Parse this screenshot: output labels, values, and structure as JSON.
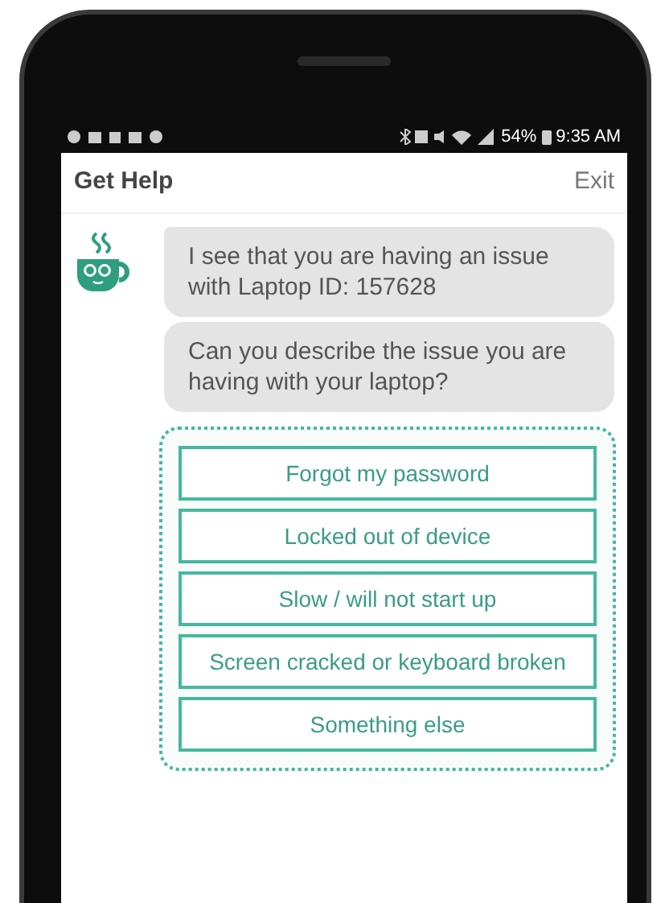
{
  "status_bar": {
    "battery": "54%",
    "time": "9:35 AM"
  },
  "header": {
    "title": "Get Help",
    "exit": "Exit"
  },
  "messages": [
    "I see that you are having an issue with Laptop ID: 157628",
    "Can you describe the issue you are having with your laptop?"
  ],
  "options": [
    "Forgot my password",
    "Locked out of device",
    "Slow / will not start up",
    "Screen cracked or keyboard broken",
    "Something else"
  ]
}
